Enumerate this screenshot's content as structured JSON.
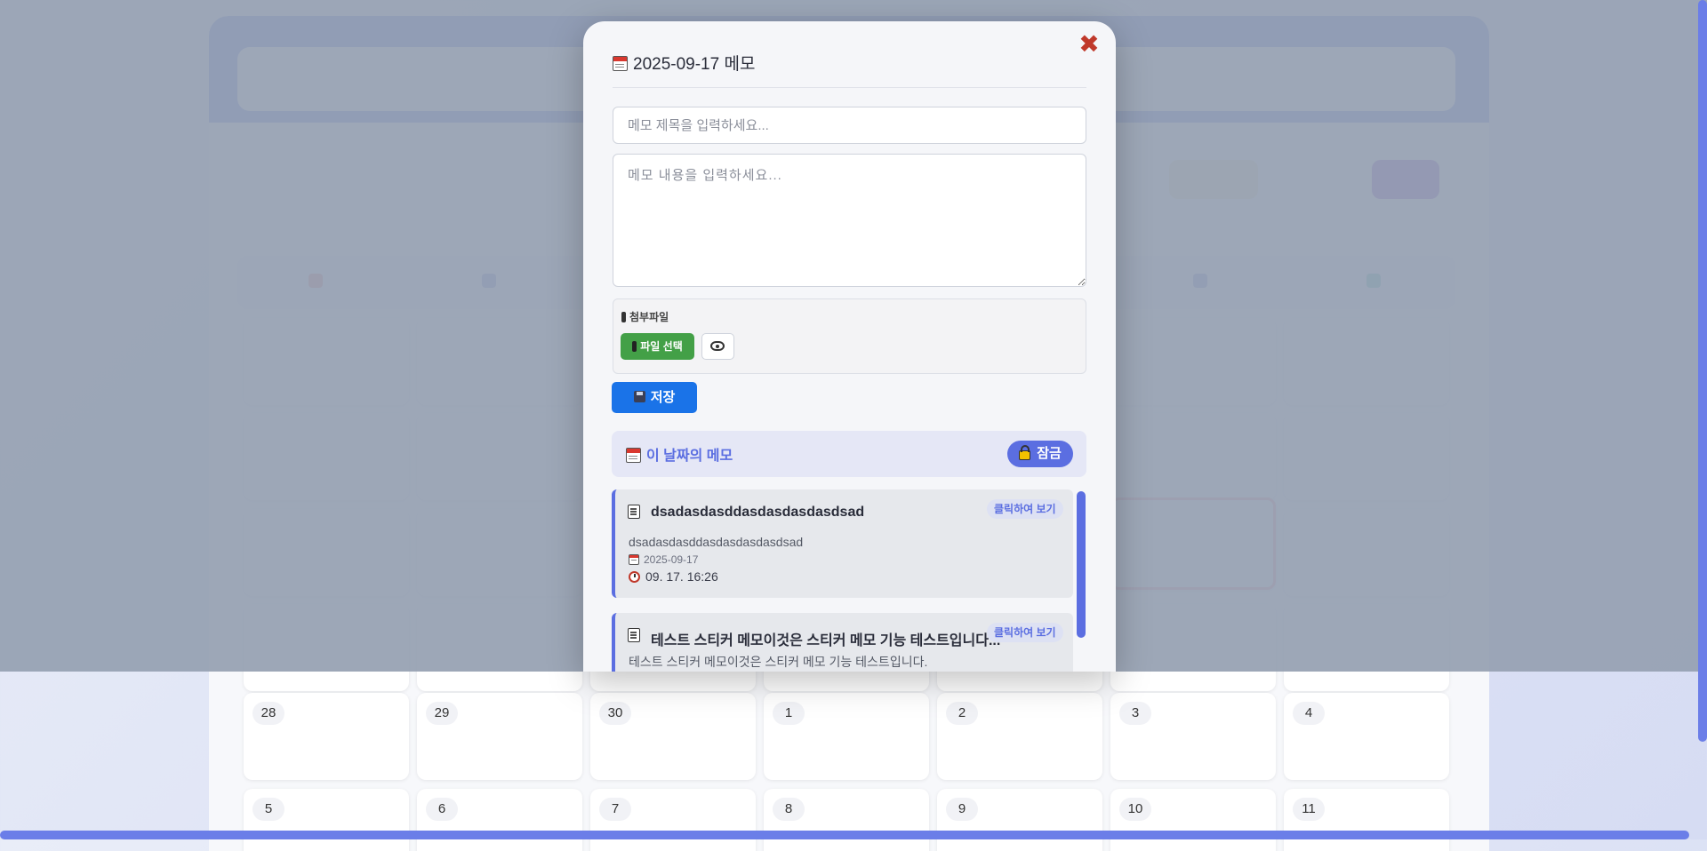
{
  "background": {
    "toolbar_items": [
      "",
      "",
      "",
      ""
    ],
    "visible_dates_row1": [
      "28",
      "29",
      "30",
      "1",
      "2",
      "3",
      "4"
    ],
    "visible_dates_row2": [
      "5",
      "6",
      "7",
      "8",
      "9",
      "10",
      "11"
    ],
    "accent": "#5b6ee1"
  },
  "modal": {
    "close_icon": "✖",
    "title": "2025-09-17 메모",
    "title_input": {
      "value": "",
      "placeholder": "메모 제목을 입력하세요..."
    },
    "content_input": {
      "value": "",
      "placeholder": "메모 내용을 입력하세요..."
    },
    "attachment": {
      "label": "첨부파일",
      "file_button": "파일 선택"
    },
    "save_button": "저장",
    "date_memos": {
      "title": "이 날짜의 메모",
      "lock_button": "잠금"
    },
    "memos": [
      {
        "title": "dsadasdasddasdasdasdasdsad",
        "content": "dsadasdasddasdasdasdasdsad",
        "date": "2025-09-17",
        "time": "09. 17. 16:26",
        "view_label": "클릭하여 보기"
      },
      {
        "title": "테스트 스티커 메모이것은 스티커 메모 기능 테스트입니다...",
        "content": "테스트 스티커 메모이것은 스티커 메모 기능 테스트입니다.",
        "view_label": "클릭하여 보기"
      }
    ]
  }
}
